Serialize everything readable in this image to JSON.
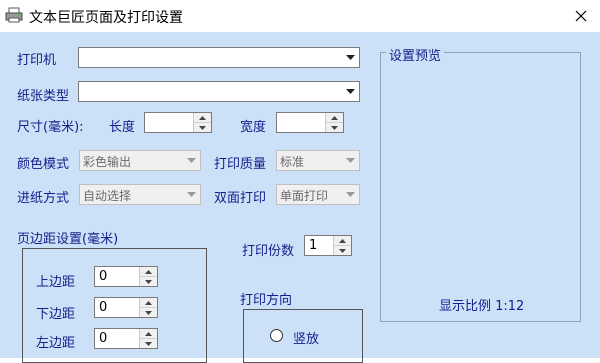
{
  "window": {
    "title": "文本巨匠页面及打印设置"
  },
  "labels": {
    "printer": "打印机",
    "paper_type": "纸张类型",
    "size": "尺寸(毫米):",
    "length": "长度",
    "width": "宽度",
    "color_mode": "颜色模式",
    "print_quality": "打印质量",
    "feed_mode": "进纸方式",
    "duplex": "双面打印",
    "margins": "页边距设置(毫米)",
    "copies": "打印份数",
    "orientation": "打印方向",
    "top_margin": "上边距",
    "bottom_margin": "下边距",
    "left_margin": "左边距",
    "portrait": "竖放"
  },
  "values": {
    "printer": "",
    "paper_type": "",
    "length": "",
    "width": "",
    "color_mode": "彩色输出",
    "print_quality": "标准",
    "feed_mode": "自动选择",
    "duplex": "单面打印",
    "copies": "1",
    "top_margin": "0",
    "bottom_margin": "0",
    "left_margin": "0"
  },
  "preview": {
    "title": "设置预览",
    "scale_label": "显示比例 1:12"
  },
  "icons": {
    "app": "printer-icon",
    "close": "close-icon",
    "dropdown": "chevron-down-icon",
    "spin_up": "spin-up-icon",
    "spin_down": "spin-down-icon"
  }
}
